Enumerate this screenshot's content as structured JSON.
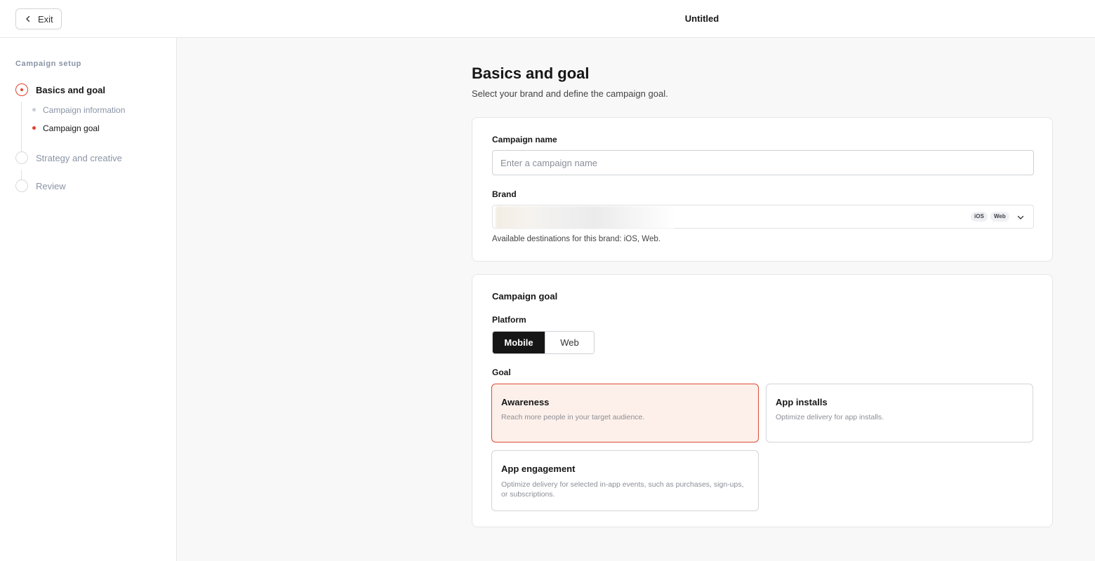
{
  "header": {
    "exit_label": "Exit",
    "title": "Untitled"
  },
  "sidebar": {
    "heading": "Campaign setup",
    "steps": [
      {
        "label": "Basics and goal",
        "status": "active",
        "substeps": [
          {
            "label": "Campaign information",
            "status": "inactive"
          },
          {
            "label": "Campaign goal",
            "status": "active"
          }
        ]
      },
      {
        "label": "Strategy and creative",
        "status": "inactive"
      },
      {
        "label": "Review",
        "status": "inactive"
      }
    ]
  },
  "main": {
    "title": "Basics and goal",
    "subtitle": "Select your brand and define the campaign goal.",
    "campaign_name": {
      "label": "Campaign name",
      "placeholder": "Enter a campaign name",
      "value": ""
    },
    "brand": {
      "label": "Brand",
      "value_hidden": true,
      "badges": [
        "iOS",
        "Web"
      ],
      "helper": "Available destinations for this brand: iOS, Web."
    },
    "goal_section": {
      "title": "Campaign goal",
      "platform_label": "Platform",
      "platform_options": [
        {
          "label": "Mobile",
          "selected": true
        },
        {
          "label": "Web",
          "selected": false
        }
      ],
      "goal_label": "Goal",
      "goals": [
        {
          "title": "Awareness",
          "description": "Reach more people in your target audience.",
          "selected": true
        },
        {
          "title": "App installs",
          "description": "Optimize delivery for app installs.",
          "selected": false
        },
        {
          "title": "App engagement",
          "description": "Optimize delivery for selected in-app events, such as purchases, sign-ups, or subscriptions.",
          "selected": false
        }
      ]
    }
  },
  "colors": {
    "accent": "#e0412f",
    "selected_card_bg": "#fdf0ea",
    "primary_button": "#161616"
  },
  "icons": {
    "exit": "chevron-left-icon",
    "brand_dropdown": "chevron-down-icon"
  }
}
